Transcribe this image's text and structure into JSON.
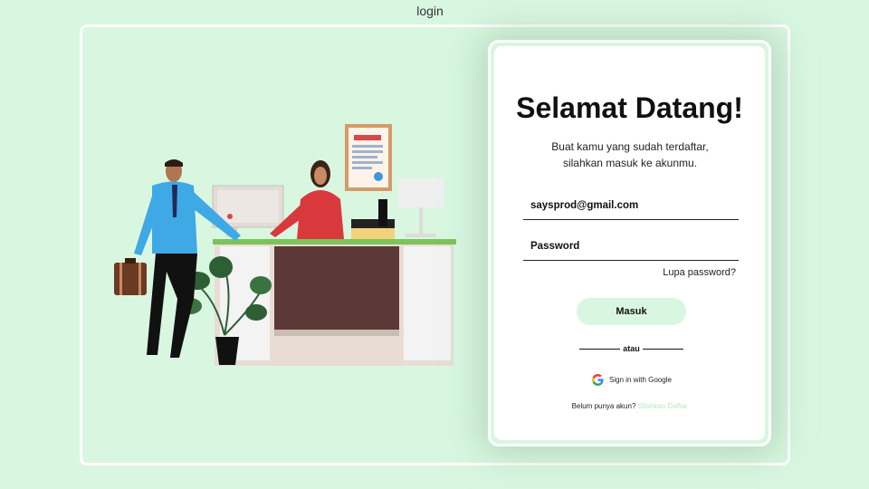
{
  "window": {
    "title": "login"
  },
  "card": {
    "heading": "Selamat Datang!",
    "subtitle": "Buat kamu yang sudah terdaftar, silahkan masuk ke akunmu.",
    "email_value": "saysprod@gmail.com",
    "password_placeholder": "Password",
    "forgot_label": "Lupa password?",
    "login_label": "Masuk",
    "divider_label": "atau",
    "google_label": "Sign in with Google",
    "register_prompt": "Belum punya akun?",
    "register_link": "Silahkan Daftar"
  },
  "colors": {
    "background": "#d9f7e0",
    "button": "#d9f7e0",
    "register_link": "#b9e8c6",
    "desk_top": "#7cc35b",
    "desk_panel": "#5c3937"
  },
  "icons": [
    "google-icon"
  ]
}
